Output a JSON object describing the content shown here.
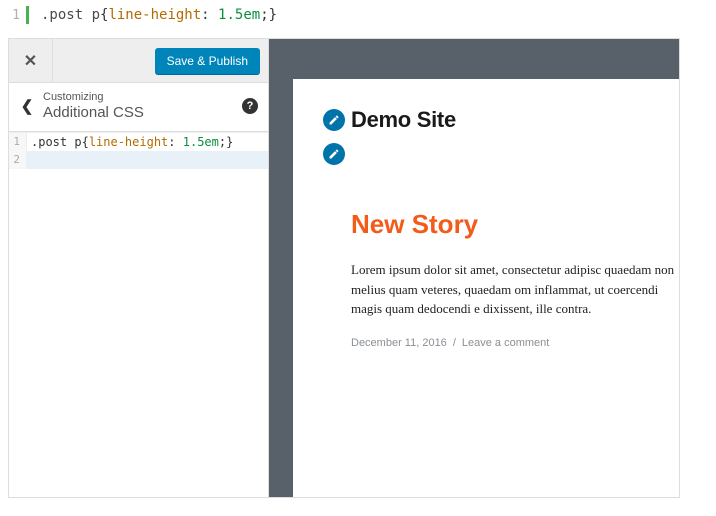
{
  "top_code": {
    "line_no": "1",
    "selector": ".post p",
    "property": "line-height",
    "value": "1.5em"
  },
  "sidebar": {
    "save_label": "Save & Publish",
    "customizing": "Customizing",
    "title": "Additional CSS",
    "help": "?"
  },
  "editor": {
    "lines": [
      {
        "no": "1",
        "selector": ".post p",
        "property": "line-height",
        "value": "1.5em"
      },
      {
        "no": "2"
      }
    ]
  },
  "preview": {
    "site_title": "Demo Site",
    "post_title": "New Story",
    "body": "Lorem ipsum dolor sit amet, consectetur adipisc quaedam non melius quam veteres, quaedam om inflammat, ut coercendi magis quam dedocendi e dixissent, ille contra.",
    "date": "December 11, 2016",
    "comment": "Leave a comment"
  }
}
